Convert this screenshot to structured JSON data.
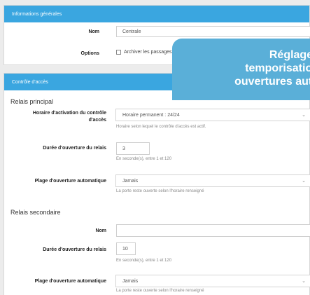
{
  "general": {
    "header": "Informations générales",
    "name_label": "Nom",
    "name_value": "Centrale",
    "options_label": "Options",
    "archive_label": "Archiver les passages"
  },
  "access": {
    "header": "Contrôle d'accès",
    "main_relay": {
      "title": "Relais principal",
      "activation_label": "Horaire d'activation du contrôle d'accès",
      "activation_value": "Horaire permanent : 24/24",
      "activation_help": "Horaire selon lequel le contrôle d'accès est actif.",
      "duration_label": "Durée d'ouverture du relais",
      "duration_value": "3",
      "duration_help": "En seconde(s), entre 1 et 120",
      "auto_label": "Plage d'ouverture automatique",
      "auto_value": "Jamais",
      "auto_help": "La porte reste ouverte selon l'horaire renseigné"
    },
    "secondary_relay": {
      "title": "Relais secondaire",
      "name_label": "Nom",
      "name_value": "",
      "duration_label": "Durée d'ouverture du relais",
      "duration_value": "10",
      "duration_help": "En seconde(s), entre 1 et 120",
      "auto_label": "Plage d'ouverture automatique",
      "auto_value": "Jamais",
      "auto_help": "La porte reste ouverte selon l'horaire renseigné"
    }
  },
  "overlay": {
    "line1": "Réglages",
    "line2": "temporisation",
    "line3": "ouvertures auto"
  },
  "colors": {
    "header_blue": "#3aa6e0",
    "overlay_blue": "#5aafd8"
  },
  "icons": {
    "chevron": "chevron-down-icon"
  }
}
